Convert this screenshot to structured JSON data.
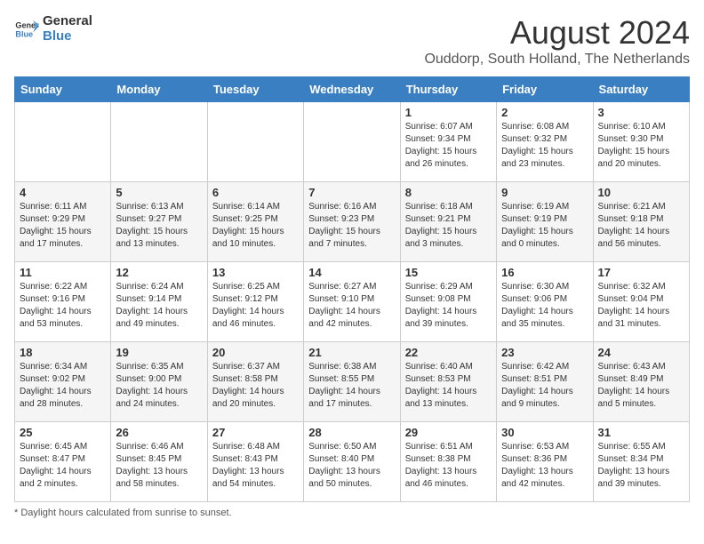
{
  "header": {
    "logo_general": "General",
    "logo_blue": "Blue",
    "month_year": "August 2024",
    "location": "Ouddorp, South Holland, The Netherlands"
  },
  "days_of_week": [
    "Sunday",
    "Monday",
    "Tuesday",
    "Wednesday",
    "Thursday",
    "Friday",
    "Saturday"
  ],
  "footer_note": "Daylight hours",
  "weeks": [
    [
      {
        "day": "",
        "info": ""
      },
      {
        "day": "",
        "info": ""
      },
      {
        "day": "",
        "info": ""
      },
      {
        "day": "",
        "info": ""
      },
      {
        "day": "1",
        "info": "Sunrise: 6:07 AM\nSunset: 9:34 PM\nDaylight: 15 hours\nand 26 minutes."
      },
      {
        "day": "2",
        "info": "Sunrise: 6:08 AM\nSunset: 9:32 PM\nDaylight: 15 hours\nand 23 minutes."
      },
      {
        "day": "3",
        "info": "Sunrise: 6:10 AM\nSunset: 9:30 PM\nDaylight: 15 hours\nand 20 minutes."
      }
    ],
    [
      {
        "day": "4",
        "info": "Sunrise: 6:11 AM\nSunset: 9:29 PM\nDaylight: 15 hours\nand 17 minutes."
      },
      {
        "day": "5",
        "info": "Sunrise: 6:13 AM\nSunset: 9:27 PM\nDaylight: 15 hours\nand 13 minutes."
      },
      {
        "day": "6",
        "info": "Sunrise: 6:14 AM\nSunset: 9:25 PM\nDaylight: 15 hours\nand 10 minutes."
      },
      {
        "day": "7",
        "info": "Sunrise: 6:16 AM\nSunset: 9:23 PM\nDaylight: 15 hours\nand 7 minutes."
      },
      {
        "day": "8",
        "info": "Sunrise: 6:18 AM\nSunset: 9:21 PM\nDaylight: 15 hours\nand 3 minutes."
      },
      {
        "day": "9",
        "info": "Sunrise: 6:19 AM\nSunset: 9:19 PM\nDaylight: 15 hours\nand 0 minutes."
      },
      {
        "day": "10",
        "info": "Sunrise: 6:21 AM\nSunset: 9:18 PM\nDaylight: 14 hours\nand 56 minutes."
      }
    ],
    [
      {
        "day": "11",
        "info": "Sunrise: 6:22 AM\nSunset: 9:16 PM\nDaylight: 14 hours\nand 53 minutes."
      },
      {
        "day": "12",
        "info": "Sunrise: 6:24 AM\nSunset: 9:14 PM\nDaylight: 14 hours\nand 49 minutes."
      },
      {
        "day": "13",
        "info": "Sunrise: 6:25 AM\nSunset: 9:12 PM\nDaylight: 14 hours\nand 46 minutes."
      },
      {
        "day": "14",
        "info": "Sunrise: 6:27 AM\nSunset: 9:10 PM\nDaylight: 14 hours\nand 42 minutes."
      },
      {
        "day": "15",
        "info": "Sunrise: 6:29 AM\nSunset: 9:08 PM\nDaylight: 14 hours\nand 39 minutes."
      },
      {
        "day": "16",
        "info": "Sunrise: 6:30 AM\nSunset: 9:06 PM\nDaylight: 14 hours\nand 35 minutes."
      },
      {
        "day": "17",
        "info": "Sunrise: 6:32 AM\nSunset: 9:04 PM\nDaylight: 14 hours\nand 31 minutes."
      }
    ],
    [
      {
        "day": "18",
        "info": "Sunrise: 6:34 AM\nSunset: 9:02 PM\nDaylight: 14 hours\nand 28 minutes."
      },
      {
        "day": "19",
        "info": "Sunrise: 6:35 AM\nSunset: 9:00 PM\nDaylight: 14 hours\nand 24 minutes."
      },
      {
        "day": "20",
        "info": "Sunrise: 6:37 AM\nSunset: 8:58 PM\nDaylight: 14 hours\nand 20 minutes."
      },
      {
        "day": "21",
        "info": "Sunrise: 6:38 AM\nSunset: 8:55 PM\nDaylight: 14 hours\nand 17 minutes."
      },
      {
        "day": "22",
        "info": "Sunrise: 6:40 AM\nSunset: 8:53 PM\nDaylight: 14 hours\nand 13 minutes."
      },
      {
        "day": "23",
        "info": "Sunrise: 6:42 AM\nSunset: 8:51 PM\nDaylight: 14 hours\nand 9 minutes."
      },
      {
        "day": "24",
        "info": "Sunrise: 6:43 AM\nSunset: 8:49 PM\nDaylight: 14 hours\nand 5 minutes."
      }
    ],
    [
      {
        "day": "25",
        "info": "Sunrise: 6:45 AM\nSunset: 8:47 PM\nDaylight: 14 hours\nand 2 minutes."
      },
      {
        "day": "26",
        "info": "Sunrise: 6:46 AM\nSunset: 8:45 PM\nDaylight: 13 hours\nand 58 minutes."
      },
      {
        "day": "27",
        "info": "Sunrise: 6:48 AM\nSunset: 8:43 PM\nDaylight: 13 hours\nand 54 minutes."
      },
      {
        "day": "28",
        "info": "Sunrise: 6:50 AM\nSunset: 8:40 PM\nDaylight: 13 hours\nand 50 minutes."
      },
      {
        "day": "29",
        "info": "Sunrise: 6:51 AM\nSunset: 8:38 PM\nDaylight: 13 hours\nand 46 minutes."
      },
      {
        "day": "30",
        "info": "Sunrise: 6:53 AM\nSunset: 8:36 PM\nDaylight: 13 hours\nand 42 minutes."
      },
      {
        "day": "31",
        "info": "Sunrise: 6:55 AM\nSunset: 8:34 PM\nDaylight: 13 hours\nand 39 minutes."
      }
    ]
  ]
}
